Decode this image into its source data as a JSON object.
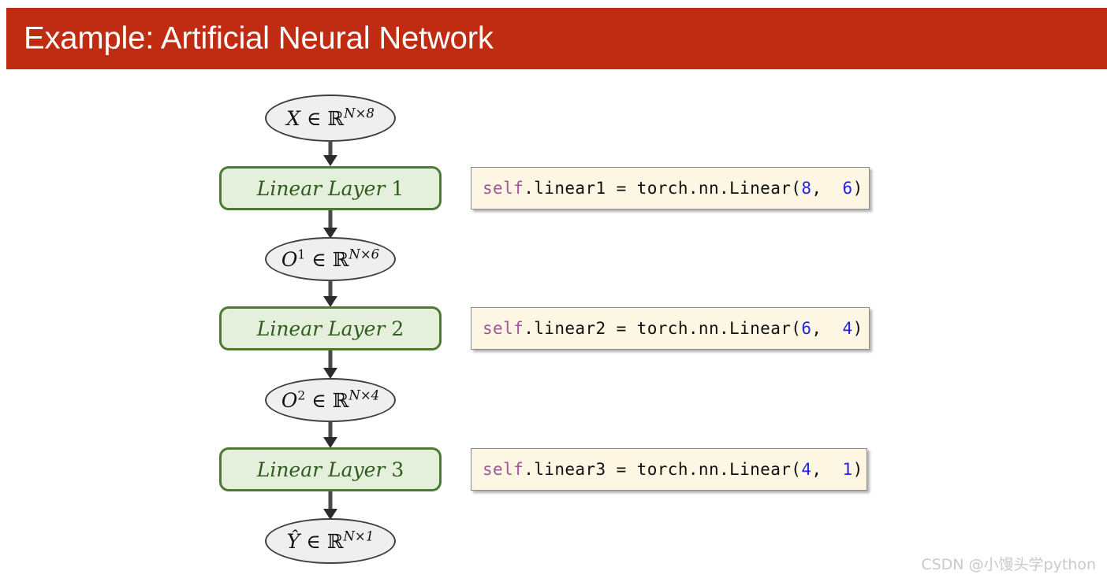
{
  "slide": {
    "title": "Example: Artificial Neural Network",
    "title_bar_color": "#bf2c12",
    "title_text_color": "#ffffff",
    "background_color": "#ffffff"
  },
  "diagram": {
    "type": "flowchart",
    "orientation": "top-to-bottom",
    "node_colors": {
      "variable_fill": "#efefef",
      "variable_border": "#3f3f3f",
      "layer_fill": "#e4efdc",
      "layer_border": "#4d7a33",
      "layer_text": "#2f5b1e",
      "arrow": "#4a4a4a"
    },
    "nodes": [
      {
        "id": "x",
        "shape": "ellipse",
        "symbol": "X",
        "superscript": "",
        "relation": "∈",
        "space": "ℝ",
        "dims": "N×8",
        "text": "X ∈ ℝ^{N×8}"
      },
      {
        "id": "l1",
        "shape": "rounded-rect",
        "label_italic": "Linear Layer",
        "label_index": "1",
        "text": "Linear Layer 1"
      },
      {
        "id": "o1",
        "shape": "ellipse",
        "symbol": "O",
        "superscript": "1",
        "relation": "∈",
        "space": "ℝ",
        "dims": "N×6",
        "text": "O¹ ∈ ℝ^{N×6}"
      },
      {
        "id": "l2",
        "shape": "rounded-rect",
        "label_italic": "Linear Layer",
        "label_index": "2",
        "text": "Linear Layer 2"
      },
      {
        "id": "o2",
        "shape": "ellipse",
        "symbol": "O",
        "superscript": "2",
        "relation": "∈",
        "space": "ℝ",
        "dims": "N×4",
        "text": "O² ∈ ℝ^{N×4}"
      },
      {
        "id": "l3",
        "shape": "rounded-rect",
        "label_italic": "Linear Layer",
        "label_index": "3",
        "text": "Linear Layer 3"
      },
      {
        "id": "yhat",
        "shape": "ellipse",
        "symbol": "Ŷ",
        "superscript": "",
        "relation": "∈",
        "space": "ℝ",
        "dims": "N×1",
        "text": "Ŷ ∈ ℝ^{N×1}"
      }
    ]
  },
  "code_boxes": [
    {
      "id": "code1",
      "background": "#fdf6e3",
      "full_text": "self.linear1 = torch.nn.Linear(8, 6)",
      "tokens": {
        "self": "self",
        "rest_before": ".linear1 = torch.nn.Linear(",
        "arg1": "8",
        "comma": ",  ",
        "arg2": "6",
        "close": ")"
      }
    },
    {
      "id": "code2",
      "background": "#fdf6e3",
      "full_text": "self.linear2 = torch.nn.Linear(6, 4)",
      "tokens": {
        "self": "self",
        "rest_before": ".linear2 = torch.nn.Linear(",
        "arg1": "6",
        "comma": ",  ",
        "arg2": "4",
        "close": ")"
      }
    },
    {
      "id": "code3",
      "background": "#fdf6e3",
      "full_text": "self.linear3 = torch.nn.Linear(4, 1)",
      "tokens": {
        "self": "self",
        "rest_before": ".linear3 = torch.nn.Linear(",
        "arg1": "4",
        "comma": ",  ",
        "arg2": "1",
        "close": ")"
      }
    }
  ],
  "watermark": {
    "text": "CSDN @小馒头学python",
    "color": "#c9c9c9"
  }
}
